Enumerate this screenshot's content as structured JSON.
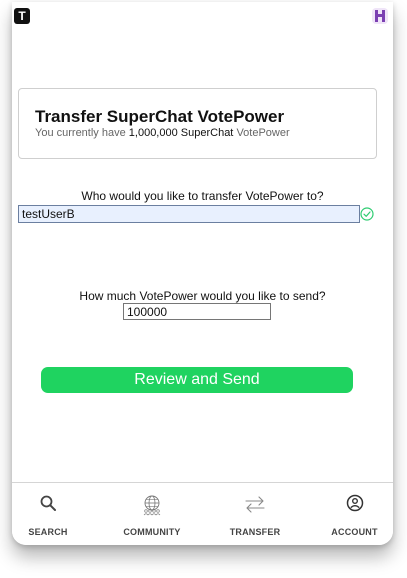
{
  "header": {
    "app_logo_letter": "T",
    "logo_color": "#111111",
    "profile_icon": "user-avatar-icon",
    "profile_icon_color": "#7b3fb2"
  },
  "card": {
    "title": "Transfer SuperChat VotePower",
    "subtitle_prefix": "You currently have",
    "balance": "1,000,000 SuperChat",
    "subtitle_suffix": "VotePower"
  },
  "recipient": {
    "question": "Who would you like to transfer VotePower to?",
    "value": "testUserB",
    "valid_icon": "check-circle-icon",
    "valid_color": "#2ecc71"
  },
  "amount": {
    "question": "How much VotePower would you like to send?",
    "value": "100000"
  },
  "actions": {
    "review_label": "Review and Send",
    "review_color": "#1fd360"
  },
  "nav": {
    "items": [
      {
        "label": "SEARCH",
        "icon": "search-icon"
      },
      {
        "label": "COMMUNITY",
        "icon": "globe-community-icon"
      },
      {
        "label": "TRANSFER",
        "icon": "transfer-arrows-icon"
      },
      {
        "label": "ACCOUNT",
        "icon": "account-icon"
      }
    ]
  }
}
